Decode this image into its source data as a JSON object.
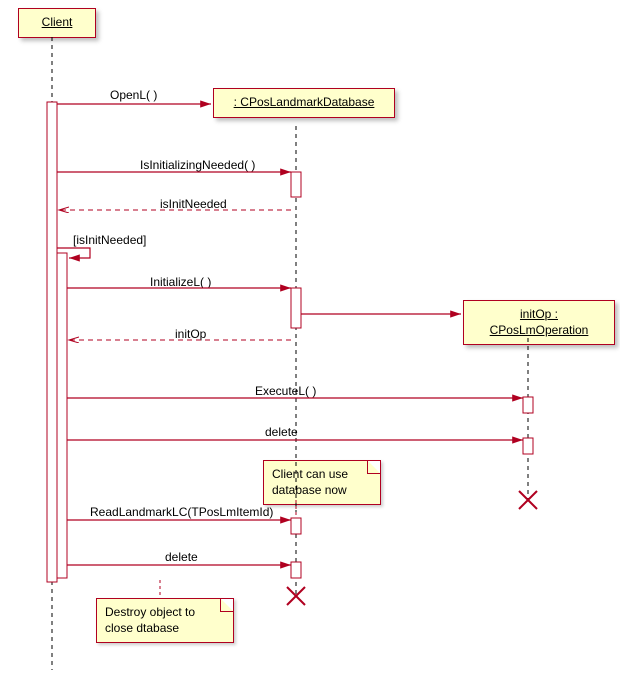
{
  "lifelines": {
    "client": {
      "name": "Client"
    },
    "database": {
      "name": ": CPosLandmarkDatabase"
    },
    "operation": {
      "name": "initOp : CPosLmOperation"
    }
  },
  "messages": {
    "open": "OpenL( )",
    "isInitNeededCall": "IsInitializingNeeded( )",
    "isInitNeededReturn": "isInitNeeded",
    "guard": "[isInitNeeded]",
    "initialize": "InitializeL( )",
    "initOpReturn": "initOp",
    "execute": "ExecuteL( )",
    "delete1": "delete",
    "readLandmark": "ReadLandmarkLC(TPosLmItemId)",
    "delete2": "delete"
  },
  "notes": {
    "canUse": "Client can use database now",
    "destroy": "Destroy object to close dtabase"
  },
  "chart_data": {
    "type": "sequence_diagram",
    "lifelines": [
      "Client",
      ": CPosLandmarkDatabase",
      "initOp : CPosLmOperation"
    ],
    "interactions": [
      {
        "from": "Client",
        "to": "CPosLandmarkDatabase",
        "label": "OpenL( )",
        "type": "create"
      },
      {
        "from": "Client",
        "to": "CPosLandmarkDatabase",
        "label": "IsInitializingNeeded( )",
        "type": "call"
      },
      {
        "from": "CPosLandmarkDatabase",
        "to": "Client",
        "label": "isInitNeeded",
        "type": "return"
      },
      {
        "from": "Client",
        "to": "Client",
        "label": "[isInitNeeded]",
        "type": "self-guard"
      },
      {
        "from": "Client",
        "to": "CPosLandmarkDatabase",
        "label": "InitializeL( )",
        "type": "call"
      },
      {
        "from": "CPosLandmarkDatabase",
        "to": "CPosLmOperation",
        "label": "",
        "type": "create"
      },
      {
        "from": "CPosLandmarkDatabase",
        "to": "Client",
        "label": "initOp",
        "type": "return"
      },
      {
        "from": "Client",
        "to": "CPosLmOperation",
        "label": "ExecuteL( )",
        "type": "call"
      },
      {
        "from": "Client",
        "to": "CPosLmOperation",
        "label": "delete",
        "type": "call"
      },
      {
        "note": "Client can use database now",
        "attached_to": "CPosLandmarkDatabase"
      },
      {
        "from": "Client",
        "to": "CPosLandmarkDatabase",
        "label": "ReadLandmarkLC(TPosLmItemId)",
        "type": "call"
      },
      {
        "from": "Client",
        "to": "CPosLandmarkDatabase",
        "label": "delete",
        "type": "call"
      },
      {
        "note": "Destroy object to close dtabase",
        "attached_to": "Client"
      }
    ]
  }
}
